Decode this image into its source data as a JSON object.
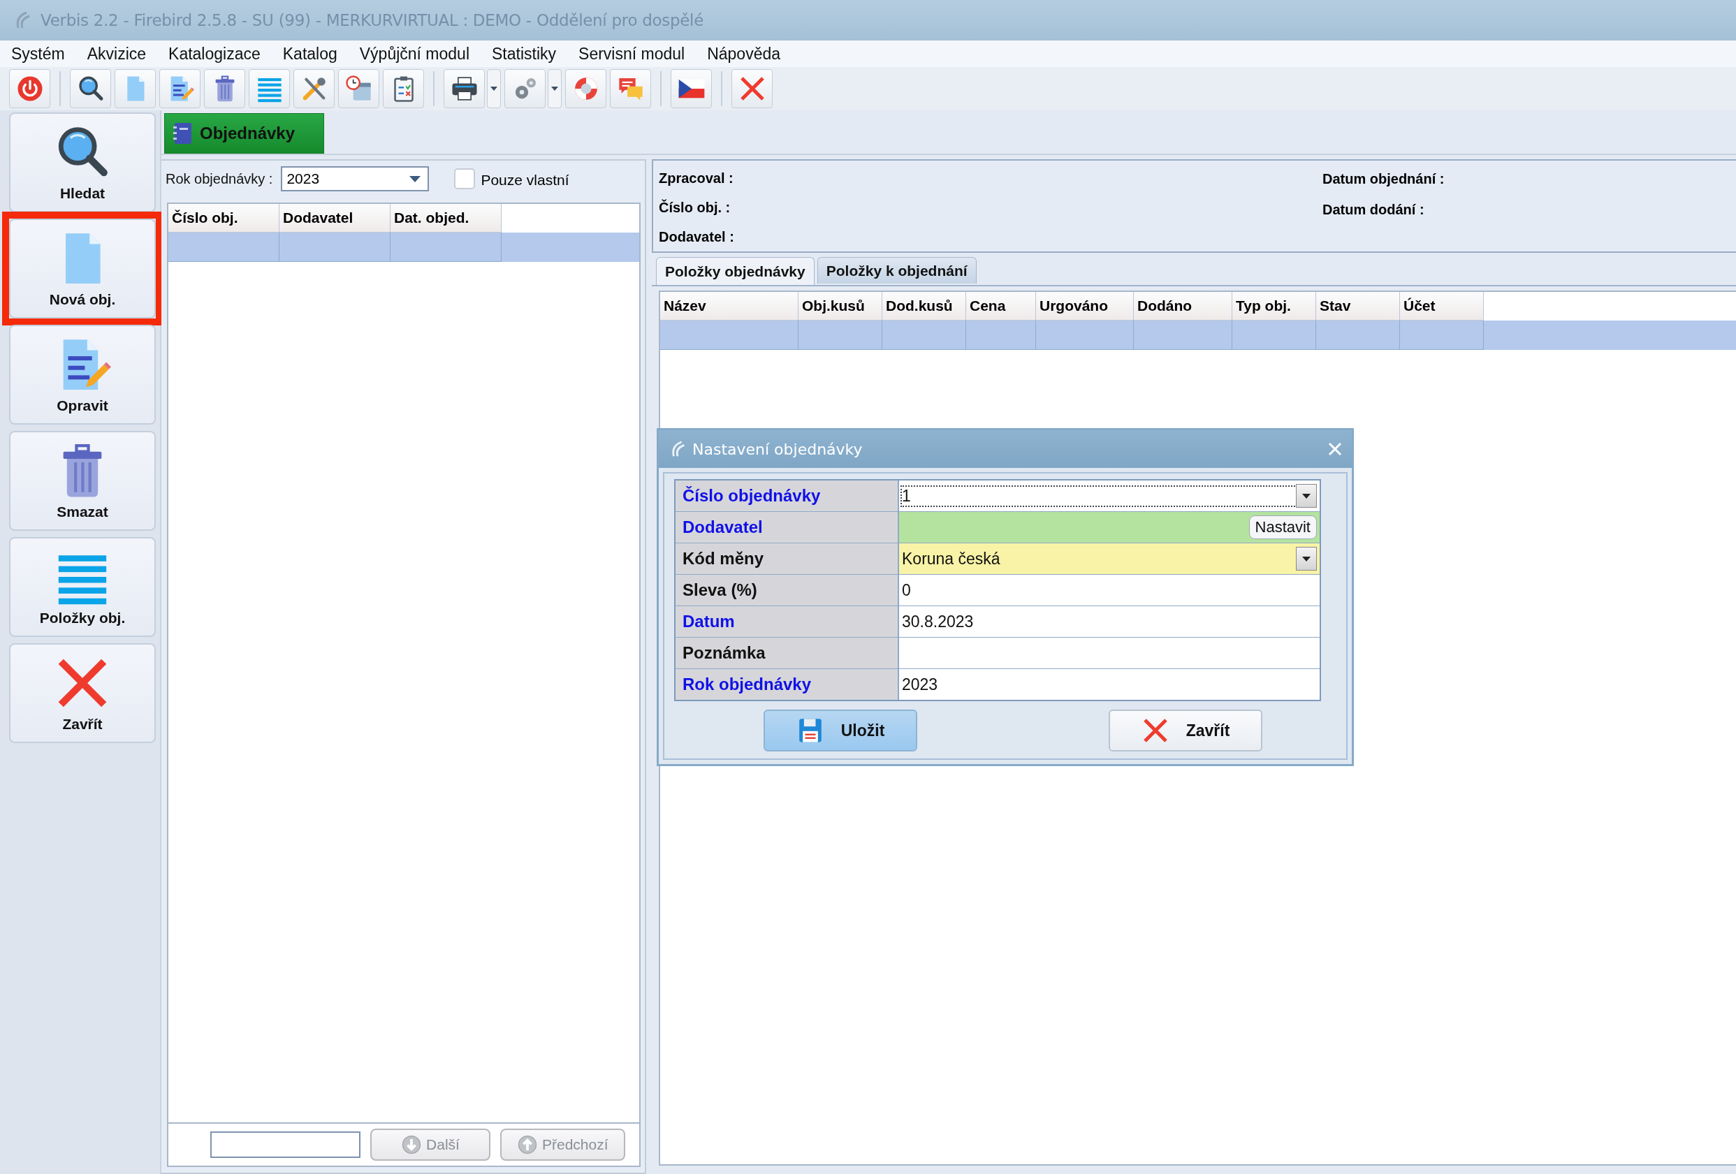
{
  "window": {
    "title": "Verbis 2.2 - Firebird 2.5.8 - SU (99) - MERKURVIRTUAL : DEMO - Oddělení pro dospělé"
  },
  "menu": [
    "Systém",
    "Akvizice",
    "Katalogizace",
    "Katalog",
    "Výpůjční modul",
    "Statistiky",
    "Servisní modul",
    "Nápověda"
  ],
  "sidebar": {
    "items": [
      {
        "label": "Hledat",
        "kind": "search",
        "highlighted": false
      },
      {
        "label": "Nová obj.",
        "kind": "doc",
        "highlighted": true
      },
      {
        "label": "Opravit",
        "kind": "edit",
        "highlighted": false
      },
      {
        "label": "Smazat",
        "kind": "trash",
        "highlighted": false
      },
      {
        "label": "Položky obj.",
        "kind": "list",
        "highlighted": false
      },
      {
        "label": "Zavřít",
        "kind": "close",
        "highlighted": false
      }
    ]
  },
  "tabs": [
    {
      "label": "Objednávky",
      "selected": true
    }
  ],
  "filter": {
    "label": "Rok objednávky :",
    "value": "2023",
    "own_only": {
      "label": "Pouze vlastní",
      "checked": false
    }
  },
  "orders_table": {
    "columns": [
      "Číslo obj.",
      "Dodavatel",
      "Dat. objed."
    ],
    "rows": [
      {
        "selected": true
      }
    ]
  },
  "pager": {
    "buttons": [
      {
        "label": "Další",
        "kind": "down",
        "disabled": true
      },
      {
        "label": "Předchozí",
        "kind": "up",
        "disabled": true
      }
    ]
  },
  "details": {
    "left": [
      "Zpracoval :",
      "Číslo obj. :",
      "Dodavatel :"
    ],
    "right": [
      "Datum objednání :",
      "Datum dodání :"
    ]
  },
  "item_tabs": [
    {
      "label": "Položky objednávky",
      "selected": true
    },
    {
      "label": "Položky k objednání",
      "selected": false
    }
  ],
  "items_table": {
    "columns": [
      "Název",
      "Obj.kusů",
      "Dod.kusů",
      "Cena",
      "Urgováno",
      "Dodáno",
      "Typ obj.",
      "Stav",
      "Účet"
    ],
    "rows": [
      {
        "selected": true
      }
    ]
  },
  "dialog": {
    "title": "Nastavení objednávky",
    "fields": [
      {
        "label": "Číslo objednávky",
        "required": true,
        "kind": "dropdown",
        "value": "1",
        "color": "#ffffff"
      },
      {
        "label": "Dodavatel",
        "required": true,
        "kind": "picker",
        "button": "Nastavit",
        "color": "#b4e3a0"
      },
      {
        "label": "Kód měny",
        "required": false,
        "kind": "dropdown",
        "value": "Koruna česká",
        "color": "#f8f3a6"
      },
      {
        "label": "Sleva (%)",
        "required": false,
        "kind": "text",
        "value": "0",
        "color": "#ffffff"
      },
      {
        "label": "Datum",
        "required": true,
        "kind": "text",
        "value": "30.8.2023",
        "color": "#ffffff"
      },
      {
        "label": "Poznámka",
        "required": false,
        "kind": "text",
        "color": "#ffffff"
      },
      {
        "label": "Rok objednávky",
        "required": true,
        "kind": "text",
        "value": "2023",
        "color": "#ffffff"
      }
    ],
    "buttons": [
      {
        "label": "Uložit",
        "kind": "save"
      },
      {
        "label": "Zavřít",
        "kind": "close"
      }
    ]
  }
}
